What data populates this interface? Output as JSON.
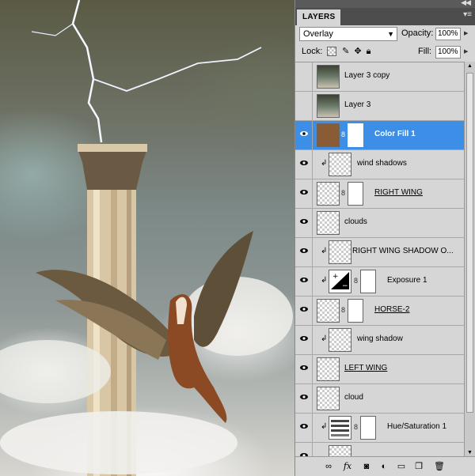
{
  "panel": {
    "tab_label": "LAYERS",
    "blend_mode": "Overlay",
    "opacity_label": "Opacity:",
    "opacity_value": "100%",
    "lock_label": "Lock:",
    "fill_label": "Fill:",
    "fill_value": "100%"
  },
  "layers": [
    {
      "name": "Layer 3 copy",
      "visible": false,
      "selected": false
    },
    {
      "name": "Layer 3",
      "visible": false,
      "selected": false
    },
    {
      "name": "Color Fill 1",
      "visible": true,
      "selected": true
    },
    {
      "name": "wind shadows",
      "visible": true,
      "selected": false
    },
    {
      "name": "RIGHT WING",
      "visible": true,
      "selected": false
    },
    {
      "name": "clouds",
      "visible": true,
      "selected": false
    },
    {
      "name": "RIGHT WING SHADOW O...",
      "visible": true,
      "selected": false
    },
    {
      "name": "Exposure 1",
      "visible": true,
      "selected": false
    },
    {
      "name": "HORSE-2",
      "visible": true,
      "selected": false
    },
    {
      "name": "wing shadow",
      "visible": true,
      "selected": false
    },
    {
      "name": "LEFT WING",
      "visible": true,
      "selected": false
    },
    {
      "name": "cloud",
      "visible": true,
      "selected": false
    },
    {
      "name": "Hue/Saturation 1",
      "visible": true,
      "selected": false
    },
    {
      "name": "",
      "visible": true,
      "selected": false
    }
  ],
  "colors": {
    "selection": "#3d8ee6",
    "fill_swatch": "#8a5c35"
  }
}
